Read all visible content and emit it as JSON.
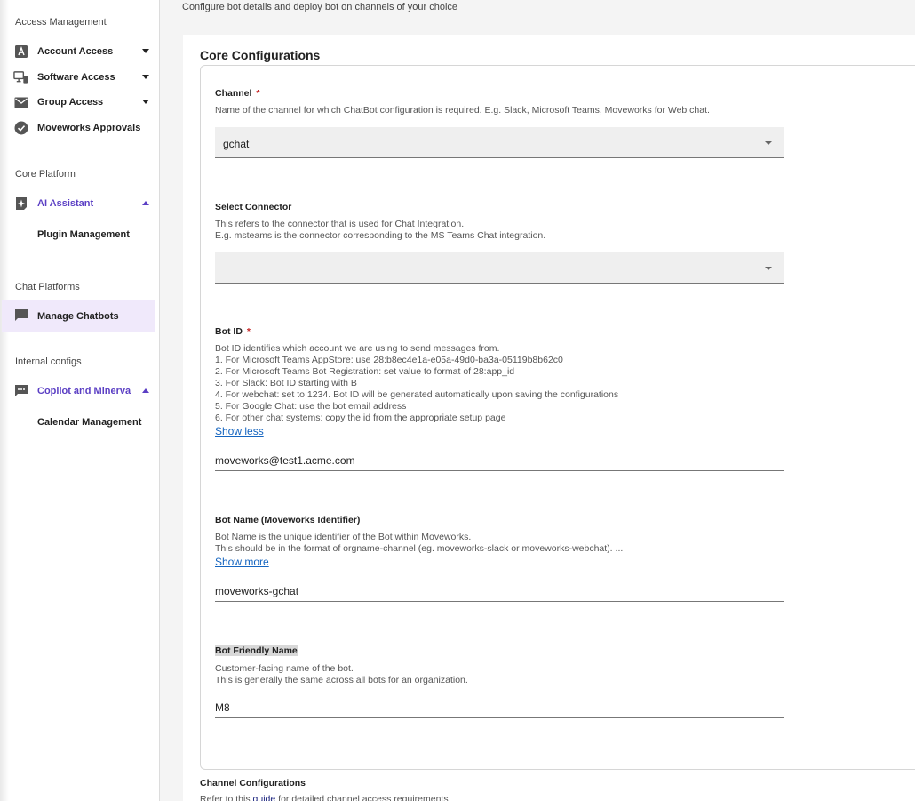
{
  "sidebar": {
    "sections": [
      {
        "title": "Access Management"
      },
      {
        "title": "Core Platform"
      },
      {
        "title": "Chat Platforms"
      },
      {
        "title": "Internal configs"
      }
    ],
    "items": {
      "account_access": "Account Access",
      "software_access": "Software Access",
      "group_access": "Group Access",
      "moveworks_approvals": "Moveworks Approvals",
      "ai_assistant": "AI Assistant",
      "plugin_management": "Plugin Management",
      "manage_chatbots": "Manage Chatbots",
      "copilot_minerva": "Copilot and Minerva",
      "calendar_management": "Calendar Management"
    },
    "accent_color": "#5b3fc4"
  },
  "main": {
    "subtitle": "Configure bot details and deploy bot on channels of your choice",
    "card_title": "Core Configurations",
    "channel": {
      "label": "Channel",
      "required_mark": "*",
      "description": "Name of the channel for which ChatBot configuration is required. E.g. Slack, Microsoft Teams, Moveworks for Web chat.",
      "value": "gchat"
    },
    "connector": {
      "label": "Select Connector",
      "desc_line1": "This refers to the connector that is used for Chat Integration.",
      "desc_line2": "E.g. msteams is the connector corresponding to the MS Teams Chat integration.",
      "value": ""
    },
    "bot_id": {
      "label": "Bot ID",
      "required_mark": "*",
      "desc_lines": [
        "Bot ID identifies which account we are using to send messages from.",
        "1. For Microsoft Teams AppStore: use 28:b8ec4e1a-e05a-49d0-ba3a-05119b8b62c0",
        "2. For Microsoft Teams Bot Registration: set value to format of 28:app_id",
        "3. For Slack: Bot ID starting with B",
        "4. For webchat: set to 1234. Bot ID will be generated automatically upon saving the configurations",
        "5. For Google Chat: use the bot email address",
        "6. For other chat systems: copy the id from the appropriate setup page"
      ],
      "toggle_link": "Show less",
      "value": "moveworks@test1.acme.com"
    },
    "bot_name": {
      "label": "Bot Name (Moveworks Identifier)",
      "desc_line1": "Bot Name is the unique identifier of the Bot within Moveworks.",
      "desc_line2": "This should be in the format of orgname-channel (eg. moveworks-slack or moveworks-webchat). ...",
      "toggle_link": "Show more",
      "value": "moveworks-gchat"
    },
    "bot_friendly_name": {
      "label": "Bot Friendly Name",
      "desc_line1": "Customer-facing name of the bot.",
      "desc_line2": "This is generally the same across all bots for an organization.",
      "value": "M8"
    },
    "channel_config": {
      "title": "Channel Configurations",
      "desc_prefix": "Refer to this ",
      "desc_link": "guide",
      "desc_suffix": " for detailed channel access requirements"
    }
  }
}
